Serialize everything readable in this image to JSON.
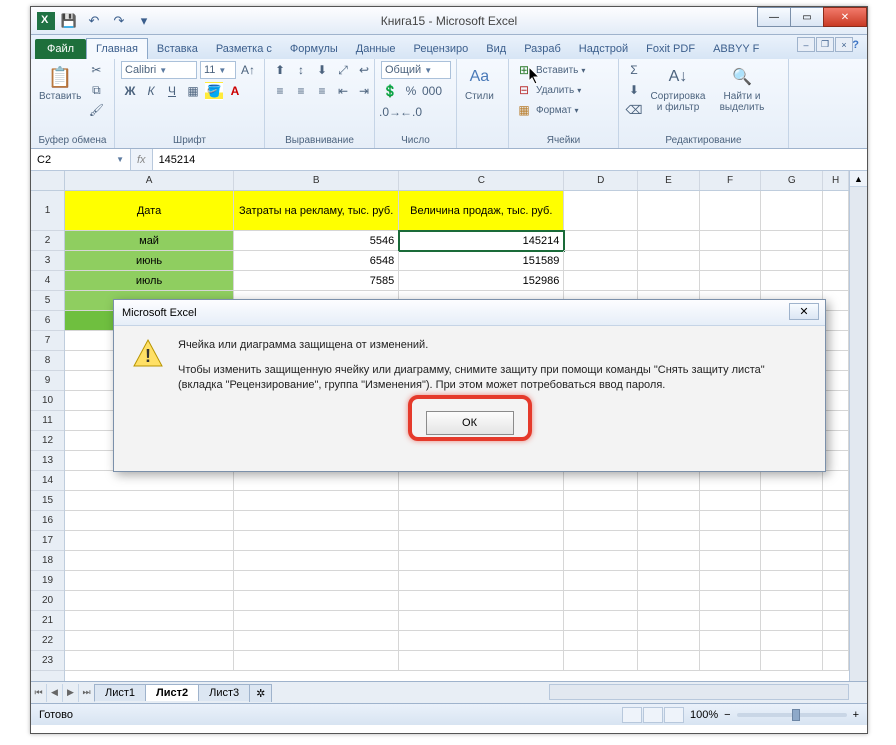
{
  "window": {
    "title": "Книга15 - Microsoft Excel"
  },
  "qat": {
    "save": "💾",
    "undo": "↶",
    "redo": "↷"
  },
  "tabs": {
    "file": "Файл",
    "items": [
      "Главная",
      "Вставка",
      "Разметка с",
      "Формулы",
      "Данные",
      "Рецензиро",
      "Вид",
      "Разраб",
      "Надстрой",
      "Foxit PDF",
      "ABBYY F"
    ]
  },
  "ribbon": {
    "clipboard": {
      "paste": "Вставить",
      "label": "Буфер обмена"
    },
    "font": {
      "name": "Calibri",
      "size": "11",
      "label": "Шрифт"
    },
    "alignment": {
      "label": "Выравнивание"
    },
    "number": {
      "format": "Общий",
      "label": "Число"
    },
    "styles": {
      "btn": "Стили"
    },
    "cells": {
      "insert": "Вставить",
      "delete": "Удалить",
      "format": "Формат",
      "label": "Ячейки"
    },
    "editing": {
      "sort": "Сортировка и фильтр",
      "find": "Найти и выделить",
      "label": "Редактирование"
    }
  },
  "namebox": "C2",
  "formula": "145214",
  "columns": [
    "A",
    "B",
    "C",
    "D",
    "E",
    "F",
    "G",
    "H"
  ],
  "rows": [
    "1",
    "2",
    "3",
    "4",
    "5",
    "6",
    "7",
    "8",
    "9",
    "10",
    "11",
    "12",
    "13",
    "14",
    "15",
    "16",
    "17",
    "18",
    "19",
    "20",
    "21",
    "22",
    "23"
  ],
  "table": {
    "headers": {
      "a": "Дата",
      "b": "Затраты на рекламу, тыс. руб.",
      "c": "Величина продаж, тыс. руб."
    },
    "data": [
      {
        "a": "май",
        "b": "5546",
        "c": "145214"
      },
      {
        "a": "июнь",
        "b": "6548",
        "c": "151589"
      },
      {
        "a": "июль",
        "b": "7585",
        "c": "152986"
      }
    ]
  },
  "sheets": {
    "items": [
      "Лист1",
      "Лист2",
      "Лист3"
    ],
    "active": 1
  },
  "status": {
    "ready": "Готово",
    "zoom": "100%"
  },
  "dialog": {
    "title": "Microsoft Excel",
    "line1": "Ячейка или диаграмма защищена от изменений.",
    "line2": "Чтобы изменить защищенную ячейку или диаграмму, снимите защиту при помощи команды \"Снять защиту листа\" (вкладка \"Рецензирование\", группа \"Изменения\"). При этом может потребоваться ввод пароля.",
    "ok": "ОК"
  }
}
